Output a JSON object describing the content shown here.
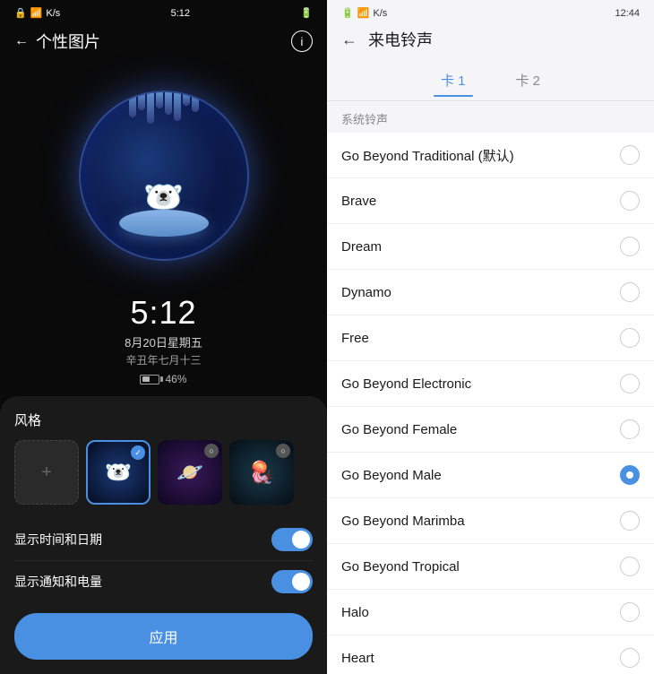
{
  "left": {
    "status": {
      "signal": "K/s",
      "time": "5:12",
      "battery": "46%"
    },
    "header": {
      "back_label": "←",
      "title": "个性图片",
      "info_label": "ⓘ"
    },
    "datetime": {
      "time": "5:12",
      "date": "8月20日星期五",
      "lunar": "辛丑年七月十三",
      "battery_pct": "46%"
    },
    "style_section": {
      "title": "风格",
      "add_label": "+",
      "apply_label": "应用",
      "toggle1_label": "显示时间和日期",
      "toggle2_label": "显示通知和电量"
    }
  },
  "right": {
    "status": {
      "signal": "K/s",
      "time": "12:44"
    },
    "header": {
      "back_label": "←",
      "title": "来电铃声"
    },
    "tabs": [
      {
        "label": "卡 1",
        "active": true
      },
      {
        "label": "卡 2",
        "active": false
      }
    ],
    "section_label": "系统铃声",
    "ringtones": [
      {
        "name": "Go Beyond Traditional (默认)",
        "selected": false
      },
      {
        "name": "Brave",
        "selected": false
      },
      {
        "name": "Dream",
        "selected": false
      },
      {
        "name": "Dynamo",
        "selected": false
      },
      {
        "name": "Free",
        "selected": false
      },
      {
        "name": "Go Beyond Electronic",
        "selected": false
      },
      {
        "name": "Go Beyond Female",
        "selected": false
      },
      {
        "name": "Go Beyond Male",
        "selected": true
      },
      {
        "name": "Go Beyond Marimba",
        "selected": false
      },
      {
        "name": "Go Beyond Tropical",
        "selected": false
      },
      {
        "name": "Halo",
        "selected": false
      },
      {
        "name": "Heart",
        "selected": false
      }
    ]
  }
}
